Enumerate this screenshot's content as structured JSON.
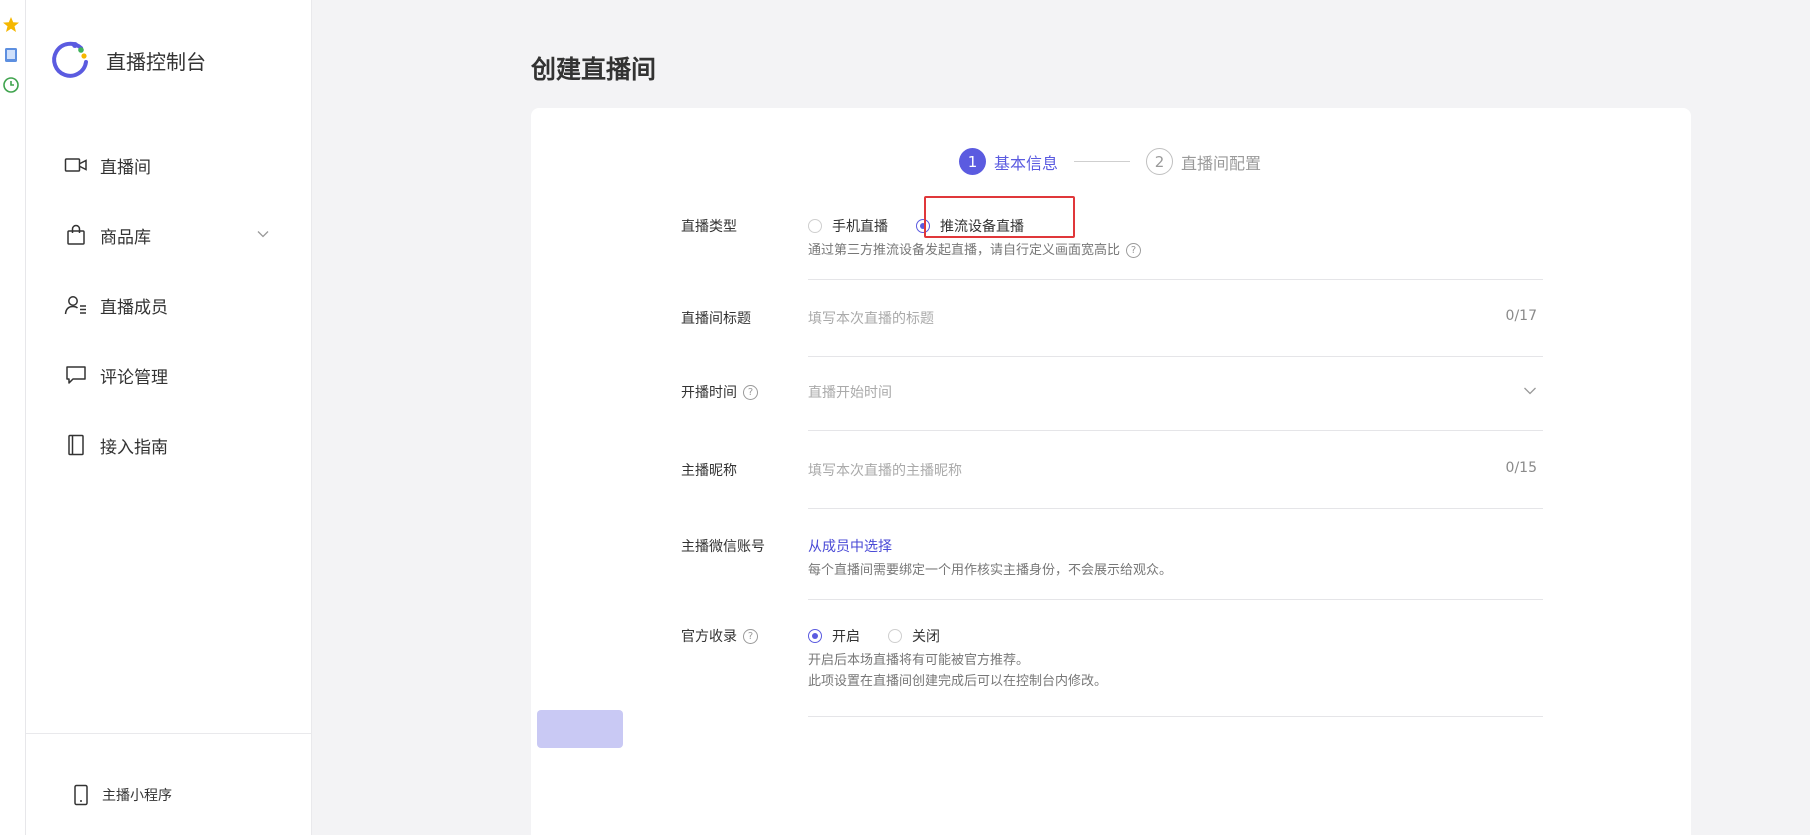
{
  "brand": {
    "name": "直播控制台"
  },
  "sidebar": {
    "items": [
      {
        "label": "直播间",
        "icon": "video-camera-icon"
      },
      {
        "label": "商品库",
        "icon": "shopping-bag-icon",
        "has_submenu": true
      },
      {
        "label": "直播成员",
        "icon": "members-icon"
      },
      {
        "label": "评论管理",
        "icon": "comment-icon"
      },
      {
        "label": "接入指南",
        "icon": "book-icon"
      }
    ],
    "bottom": {
      "label": "主播小程序",
      "icon": "mobile-phone-icon"
    }
  },
  "page": {
    "title": "创建直播间"
  },
  "steps": [
    {
      "num": "1",
      "label": "基本信息",
      "active": true
    },
    {
      "num": "2",
      "label": "直播间配置",
      "active": false
    }
  ],
  "form": {
    "live_type": {
      "label": "直播类型",
      "options": [
        "手机直播",
        "推流设备直播"
      ],
      "selected": "推流设备直播",
      "desc": "通过第三方推流设备发起直播，请自行定义画面宽高比"
    },
    "title": {
      "label": "直播间标题",
      "placeholder": "填写本次直播的标题",
      "counter": "0/17"
    },
    "start_time": {
      "label": "开播时间",
      "placeholder": "直播开始时间"
    },
    "anchor_nickname": {
      "label": "主播昵称",
      "placeholder": "填写本次直播的主播昵称",
      "counter": "0/15"
    },
    "anchor_wechat": {
      "label": "主播微信账号",
      "link": "从成员中选择",
      "desc": "每个直播间需要绑定一个用作核实主播身份，不会展示给观众。"
    },
    "official": {
      "label": "官方收录",
      "options": [
        "开启",
        "关闭"
      ],
      "selected": "开启",
      "desc1": "开启后本场直播将有可能被官方推荐。",
      "desc2": "此项设置在直播间创建完成后可以在控制台内修改。"
    }
  },
  "colors": {
    "accent": "#5b5be0",
    "highlight": "#e0373a"
  }
}
